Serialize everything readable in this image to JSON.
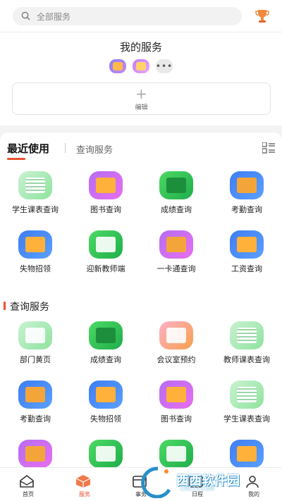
{
  "search": {
    "placeholder": "全部服务"
  },
  "my_services": {
    "title": "我的服务",
    "more_label": "•••",
    "edit_label": "编辑"
  },
  "tabs": {
    "active": "最近使用",
    "other": "查询服务"
  },
  "recent": [
    {
      "label": "学生课表查询",
      "icon": "timetable-icon"
    },
    {
      "label": "图书查询",
      "icon": "book-icon"
    },
    {
      "label": "成绩查询",
      "icon": "grade-icon"
    },
    {
      "label": "考勤查询",
      "icon": "attendance-bag-icon"
    },
    {
      "label": "失物招领",
      "icon": "lost-found-icon"
    },
    {
      "label": "迎新教师端",
      "icon": "graduate-icon"
    },
    {
      "label": "一卡通查询",
      "icon": "card-icon"
    },
    {
      "label": "工资查询",
      "icon": "salary-icon"
    }
  ],
  "query_section": {
    "title": "查询服务"
  },
  "query": [
    {
      "label": "部门黄页",
      "icon": "yellow-pages-icon"
    },
    {
      "label": "成绩查询",
      "icon": "grade-icon"
    },
    {
      "label": "会议室预约",
      "icon": "meeting-room-icon"
    },
    {
      "label": "教师课表查询",
      "icon": "timetable-icon"
    },
    {
      "label": "考勤查询",
      "icon": "attendance-bag-icon"
    },
    {
      "label": "失物招领",
      "icon": "lost-found-icon"
    },
    {
      "label": "图书查询",
      "icon": "book-icon"
    },
    {
      "label": "学生课表查询",
      "icon": "timetable-icon"
    }
  ],
  "nav": [
    {
      "label": "首页",
      "icon": "home-icon"
    },
    {
      "label": "服务",
      "icon": "service-box-icon"
    },
    {
      "label": "事务",
      "icon": "task-icon"
    },
    {
      "label": "日程",
      "icon": "calendar-icon"
    },
    {
      "label": "我的",
      "icon": "profile-icon"
    }
  ],
  "watermark": {
    "brand": "西西软件园",
    "url": "CR173.COM"
  },
  "colors": {
    "accent": "#e8502f"
  }
}
